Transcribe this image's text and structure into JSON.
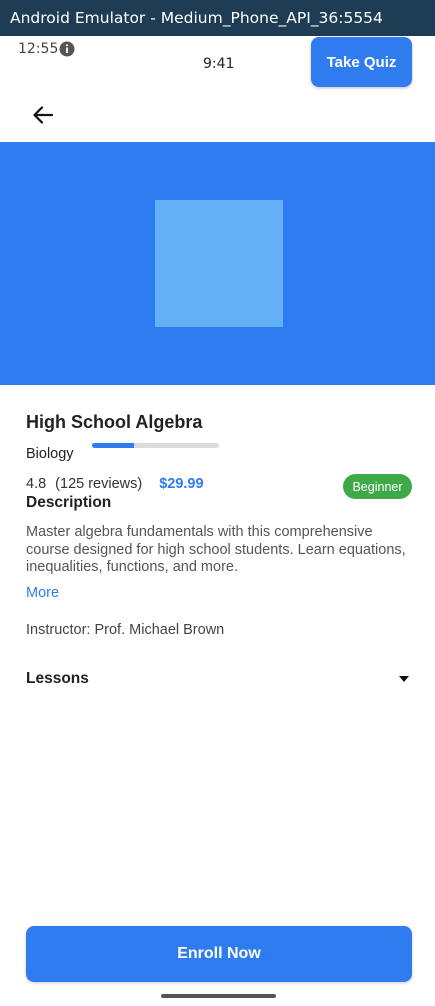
{
  "window": {
    "title": "Android Emulator - Medium_Phone_API_36:5554"
  },
  "status_bar": {
    "time": "12:55",
    "icons": [
      "info-icon",
      "wifi-icon",
      "signal-icon",
      "battery-icon"
    ]
  },
  "app_bar": {
    "clock": "9:41",
    "take_quiz_label": "Take Quiz",
    "back_icon": "arrow-left-icon"
  },
  "course": {
    "title": "High School Algebra",
    "category": "Biology",
    "progress": 0.33,
    "rating": "4.8",
    "reviews": "(125 reviews)",
    "price": "$29.99",
    "level": "Beginner",
    "description_heading": "Description",
    "description": "Master algebra fundamentals with this comprehensive course designed for high school students. Learn equations, inequalities, functions, and more.",
    "more_label": "More",
    "instructor": "Instructor: Prof. Michael Brown",
    "lessons_label": "Lessons"
  },
  "footer": {
    "enroll_label": "Enroll Now"
  },
  "colors": {
    "primary": "#2f7cf0",
    "hero_thumb": "#64b0f7",
    "badge": "#3fa94a",
    "titlebar": "#1e3c54"
  }
}
